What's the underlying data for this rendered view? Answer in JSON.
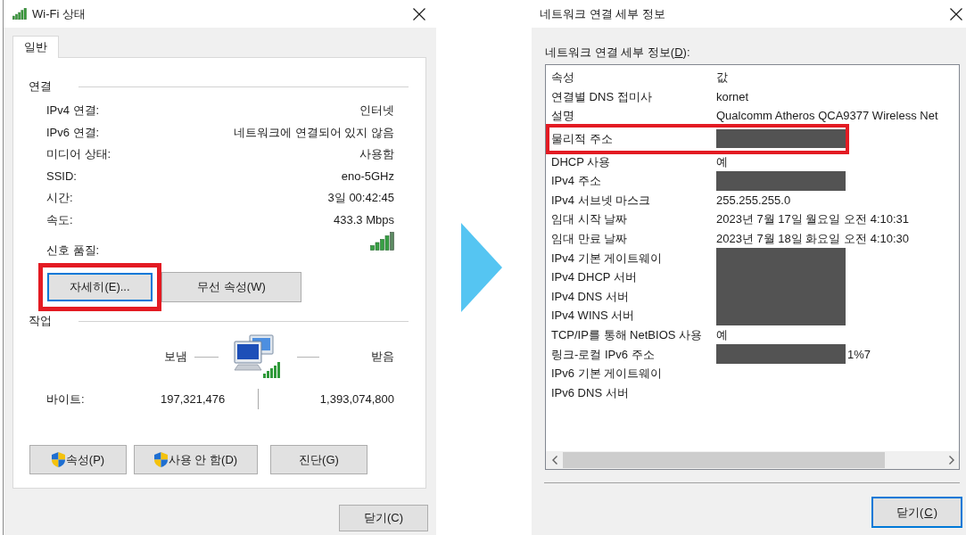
{
  "status_window": {
    "title": "Wi-Fi 상태",
    "tabs": [
      {
        "label": "일반",
        "selected": true
      }
    ],
    "connection": {
      "heading": "연결",
      "rows": [
        {
          "kind": "text",
          "label": "IPv4 연결:",
          "value": "인터넷"
        },
        {
          "kind": "text",
          "label": "IPv6 연결:",
          "value": "네트워크에 연결되어 있지 않음"
        },
        {
          "kind": "text",
          "label": "미디어 상태:",
          "value": "사용함"
        },
        {
          "kind": "text",
          "label": "SSID:",
          "value": "eno-5GHz"
        },
        {
          "kind": "text",
          "label": "시간:",
          "value": "3일 00:42:45"
        },
        {
          "kind": "text",
          "label": "속도:",
          "value": "433.3 Mbps"
        },
        {
          "kind": "signal",
          "label": "신호 품질:"
        }
      ],
      "buttons": [
        {
          "label": "자세히(E)...",
          "focused": true,
          "highlighted": true
        },
        {
          "label": "무선 속성(W)",
          "focused": false,
          "highlighted": false
        }
      ]
    },
    "activity": {
      "heading": "작업",
      "sent_label": "보냄",
      "received_label": "받음",
      "bytes_label": "바이트:",
      "bytes_sent": "197,321,476",
      "bytes_received": "1,393,074,800",
      "buttons": [
        {
          "label": "속성(P)",
          "shield": true
        },
        {
          "label": "사용 안 함(D)",
          "shield": true
        },
        {
          "label": "진단(G)",
          "shield": false
        }
      ]
    },
    "close_button": {
      "label": "닫기(C)",
      "focused": false
    }
  },
  "details_window": {
    "title": "네트워크 연결 세부 정보",
    "list_label": {
      "before": "네트워크 연결 세부 정보(",
      "key": "D",
      "after": "):"
    },
    "columns": [
      "속성",
      "값"
    ],
    "rows": [
      {
        "property": "연결별 DNS 접미사",
        "value": "kornet",
        "redacted": false,
        "highlighted": false
      },
      {
        "property": "설명",
        "value": "Qualcomm Atheros QCA9377 Wireless Net",
        "redacted": false,
        "highlighted": false
      },
      {
        "property": "물리적 주소",
        "redacted": true,
        "highlighted": true
      },
      {
        "property": "DHCP 사용",
        "value": "예",
        "redacted": false,
        "highlighted": false
      },
      {
        "property": "IPv4 주소",
        "redacted": true,
        "highlighted": false
      },
      {
        "property": "IPv4 서브넷 마스크",
        "value": "255.255.255.0",
        "redacted": false,
        "highlighted": false
      },
      {
        "property": "임대 시작 날짜",
        "value": "2023년 7월 17일 월요일 오전 4:10:31",
        "redacted": false,
        "highlighted": false
      },
      {
        "property": "임대 만료 날짜",
        "value": "2023년 7월 18일 화요일 오전 4:10:30",
        "redacted": false,
        "highlighted": false
      },
      {
        "property": "IPv4 기본 게이트웨이",
        "redacted": true,
        "highlighted": false
      },
      {
        "property": "IPv4 DHCP 서버",
        "redacted": true,
        "highlighted": false
      },
      {
        "property": "IPv4 DNS 서버",
        "redacted": true,
        "highlighted": false
      },
      {
        "property": "IPv4 WINS 서버",
        "redacted": true,
        "highlighted": false
      },
      {
        "property": "TCP/IP를 통해 NetBIOS 사용",
        "value": "예",
        "redacted": false,
        "highlighted": false
      },
      {
        "property": "링크-로컬 IPv6 주소",
        "value": "1%7",
        "redacted": true,
        "highlighted": false
      },
      {
        "property": "IPv6 기본 게이트웨이",
        "redacted": false,
        "highlighted": false
      },
      {
        "property": "IPv6 DNS 서버",
        "redacted": false,
        "highlighted": false
      }
    ],
    "close_button": {
      "before": "닫기(",
      "key": "C",
      "after": ")",
      "focused": true
    }
  }
}
